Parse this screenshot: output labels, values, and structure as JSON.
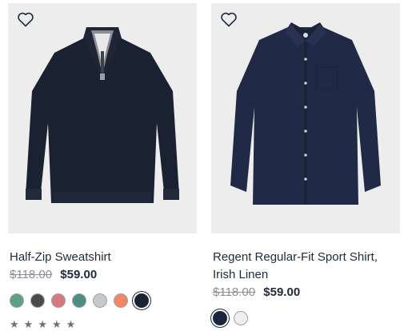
{
  "products": [
    {
      "name": "Half-Zip Sweatshirt",
      "original_price": "$118.00",
      "sale_price": "$59.00",
      "icons": {
        "favorite": "heart-outline-icon"
      },
      "swatch_colors": [
        "#5fa184",
        "#4a4a4a",
        "#d77a7e",
        "#4f8c83",
        "#c7c7c7",
        "#f08866",
        "#1b2233"
      ],
      "selected_swatch": 6,
      "rating_stars": 5
    },
    {
      "name": "Regent Regular-Fit Sport Shirt, Irish Linen",
      "original_price": "$118.00",
      "sale_price": "$59.00",
      "icons": {
        "favorite": "heart-outline-icon"
      },
      "swatch_colors": [
        "#1b2540",
        "#eeeef2"
      ],
      "selected_swatch": 0
    }
  ]
}
